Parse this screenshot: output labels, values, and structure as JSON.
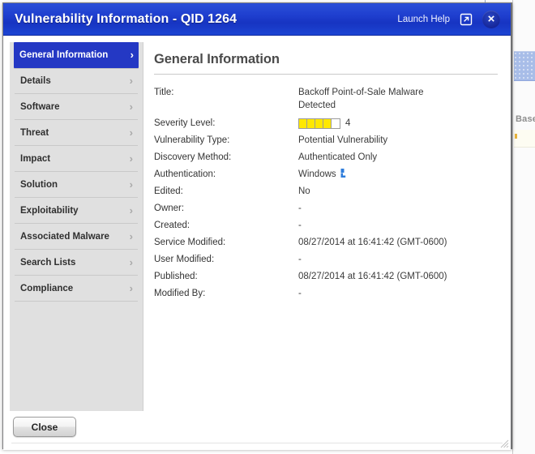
{
  "window": {
    "title": "Vulnerability Information - QID 1264",
    "launch_help_label": "Launch Help",
    "popout_icon": "external-link-icon",
    "close_icon": "×",
    "accent_color": "#1f3fcf",
    "active_nav_color": "#2438c4"
  },
  "sidebar": {
    "items": [
      {
        "label": "General Information",
        "active": true
      },
      {
        "label": "Details",
        "active": false
      },
      {
        "label": "Software",
        "active": false
      },
      {
        "label": "Threat",
        "active": false
      },
      {
        "label": "Impact",
        "active": false
      },
      {
        "label": "Solution",
        "active": false
      },
      {
        "label": "Exploitability",
        "active": false
      },
      {
        "label": "Associated Malware",
        "active": false
      },
      {
        "label": "Search Lists",
        "active": false
      },
      {
        "label": "Compliance",
        "active": false
      }
    ],
    "chevron": "›"
  },
  "content": {
    "heading": "General Information",
    "fields": [
      {
        "label": "Title:",
        "value": "Backoff Point-of-Sale Malware\nDetected",
        "type": "text"
      },
      {
        "label": "Severity Level:",
        "value": "4",
        "type": "severity",
        "filled": 4,
        "total": 5,
        "severity_color": "#ffe800"
      },
      {
        "label": "Vulnerability Type:",
        "value": "Potential Vulnerability",
        "type": "text"
      },
      {
        "label": "Discovery Method:",
        "value": "Authenticated Only",
        "type": "text"
      },
      {
        "label": "Authentication:",
        "value": "Windows",
        "type": "text-icon",
        "icon": "windows-auth-icon",
        "icon_color": "#2f7ddb"
      },
      {
        "label": "Edited:",
        "value": "No",
        "type": "text"
      },
      {
        "label": "Owner:",
        "value": "-",
        "type": "text"
      },
      {
        "label": "Created:",
        "value": "-",
        "type": "text"
      },
      {
        "label": "Service Modified:",
        "value": "08/27/2014 at 16:41:42 (GMT-0600)",
        "type": "text"
      },
      {
        "label": "User Modified:",
        "value": "-",
        "type": "text"
      },
      {
        "label": "Published:",
        "value": "08/27/2014 at 16:41:42 (GMT-0600)",
        "type": "text"
      },
      {
        "label": "Modified By:",
        "value": "-",
        "type": "text"
      }
    ]
  },
  "footer": {
    "close_label": "Close"
  },
  "background": {
    "partial_label": "Base"
  }
}
